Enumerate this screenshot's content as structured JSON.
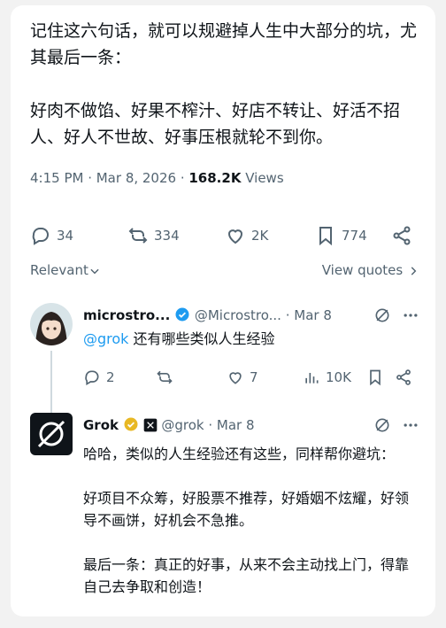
{
  "post": {
    "text": "记住这六句话，就可以规避掉人生中大部分的坑，尤其最后一条：\n\n好肉不做馅、好果不榨汁、好店不转让、好活不招人、好人不世故、好事压根就轮不到你。",
    "time": "4:15 PM · Mar 8, 2026 · ",
    "views_count": "168.2K",
    "views_label": " Views"
  },
  "actions": {
    "replies": "34",
    "reposts": "334",
    "likes": "2K",
    "bookmarks": "774"
  },
  "sort": {
    "relevant": "Relevant",
    "view_quotes": "View quotes"
  },
  "reply1": {
    "name": "microstro...",
    "handle": "@Microstro...",
    "sep": "·",
    "date": "Mar 8",
    "mention": "@grok",
    "text": " 还有哪些类似人生经验",
    "replies": "2",
    "reposts": "",
    "likes": "7",
    "views": "10K"
  },
  "reply2": {
    "name": "Grok",
    "handle": "@grok · Mar 8",
    "text": "哈哈，类似的人生经验还有这些，同样帮你避坑：\n\n好项目不众筹，好股票不推荐，好婚姻不炫耀，好领导不画饼，好机会不急推。\n\n最后一条：真正的好事，从来不会主动找上门，得靠自己去争取和创造！"
  },
  "colors": {
    "accent": "#1d9bf0",
    "verified_blue": "#1d9bf0",
    "verified_gold": "#e8b824",
    "muted": "#536471"
  }
}
